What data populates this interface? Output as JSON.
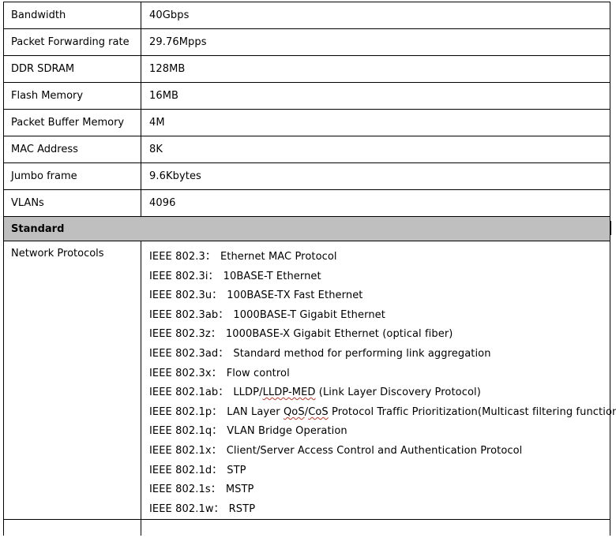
{
  "specs": [
    {
      "label": "Bandwidth",
      "value": "40Gbps"
    },
    {
      "label": "Packet Forwarding rate",
      "value": "29.76Mpps"
    },
    {
      "label": "DDR SDRAM",
      "value": "128MB"
    },
    {
      "label": "Flash Memory",
      "value": "16MB"
    },
    {
      "label": "Packet Buffer Memory",
      "value": "4M"
    },
    {
      "label": "MAC Address",
      "value": "8K"
    },
    {
      "label": "Jumbo frame",
      "value": "9.6Kbytes"
    },
    {
      "label": "VLANs",
      "value": "4096"
    }
  ],
  "standard_header": "Standard",
  "network_protocols": {
    "label": "Network Protocols",
    "items": [
      {
        "code": "IEEE 802.3：",
        "desc": "Ethernet MAC Protocol"
      },
      {
        "code": "IEEE 802.3i：",
        "desc": "10BASE-T Ethernet"
      },
      {
        "code": "IEEE 802.3u：",
        "desc": "100BASE-TX Fast Ethernet"
      },
      {
        "code": "IEEE 802.3ab：",
        "desc": "1000BASE-T Gigabit Ethernet"
      },
      {
        "code": "IEEE 802.3z：",
        "desc": "1000BASE-X Gigabit Ethernet (optical fiber)"
      },
      {
        "code": "IEEE 802.3ad：",
        "desc": "Standard method for performing link aggregation"
      },
      {
        "code": "IEEE 802.3x：",
        "desc": "Flow control"
      },
      {
        "code": "IEEE 802.1ab：",
        "desc": "LLDP/LLDP-MED (Link Layer Discovery Protocol)"
      },
      {
        "code": "IEEE 802.1p：",
        "desc": "LAN Layer QoS/CoS Protocol Traffic Prioritization(Multicast filtering function)"
      },
      {
        "code": "IEEE 802.1q：",
        "desc": "VLAN Bridge Operation"
      },
      {
        "code": "IEEE 802.1x：",
        "desc": "Client/Server Access Control and Authentication Protocol"
      },
      {
        "code": "IEEE 802.1d：",
        "desc": "STP"
      },
      {
        "code": "IEEE 802.1s：",
        "desc": "MSTP"
      },
      {
        "code": "IEEE 802.1w：",
        "desc": "RSTP"
      }
    ]
  },
  "colors": {
    "header_bg": "#bfbfbf",
    "border": "#000000",
    "spell_underline": "#c0392b"
  }
}
